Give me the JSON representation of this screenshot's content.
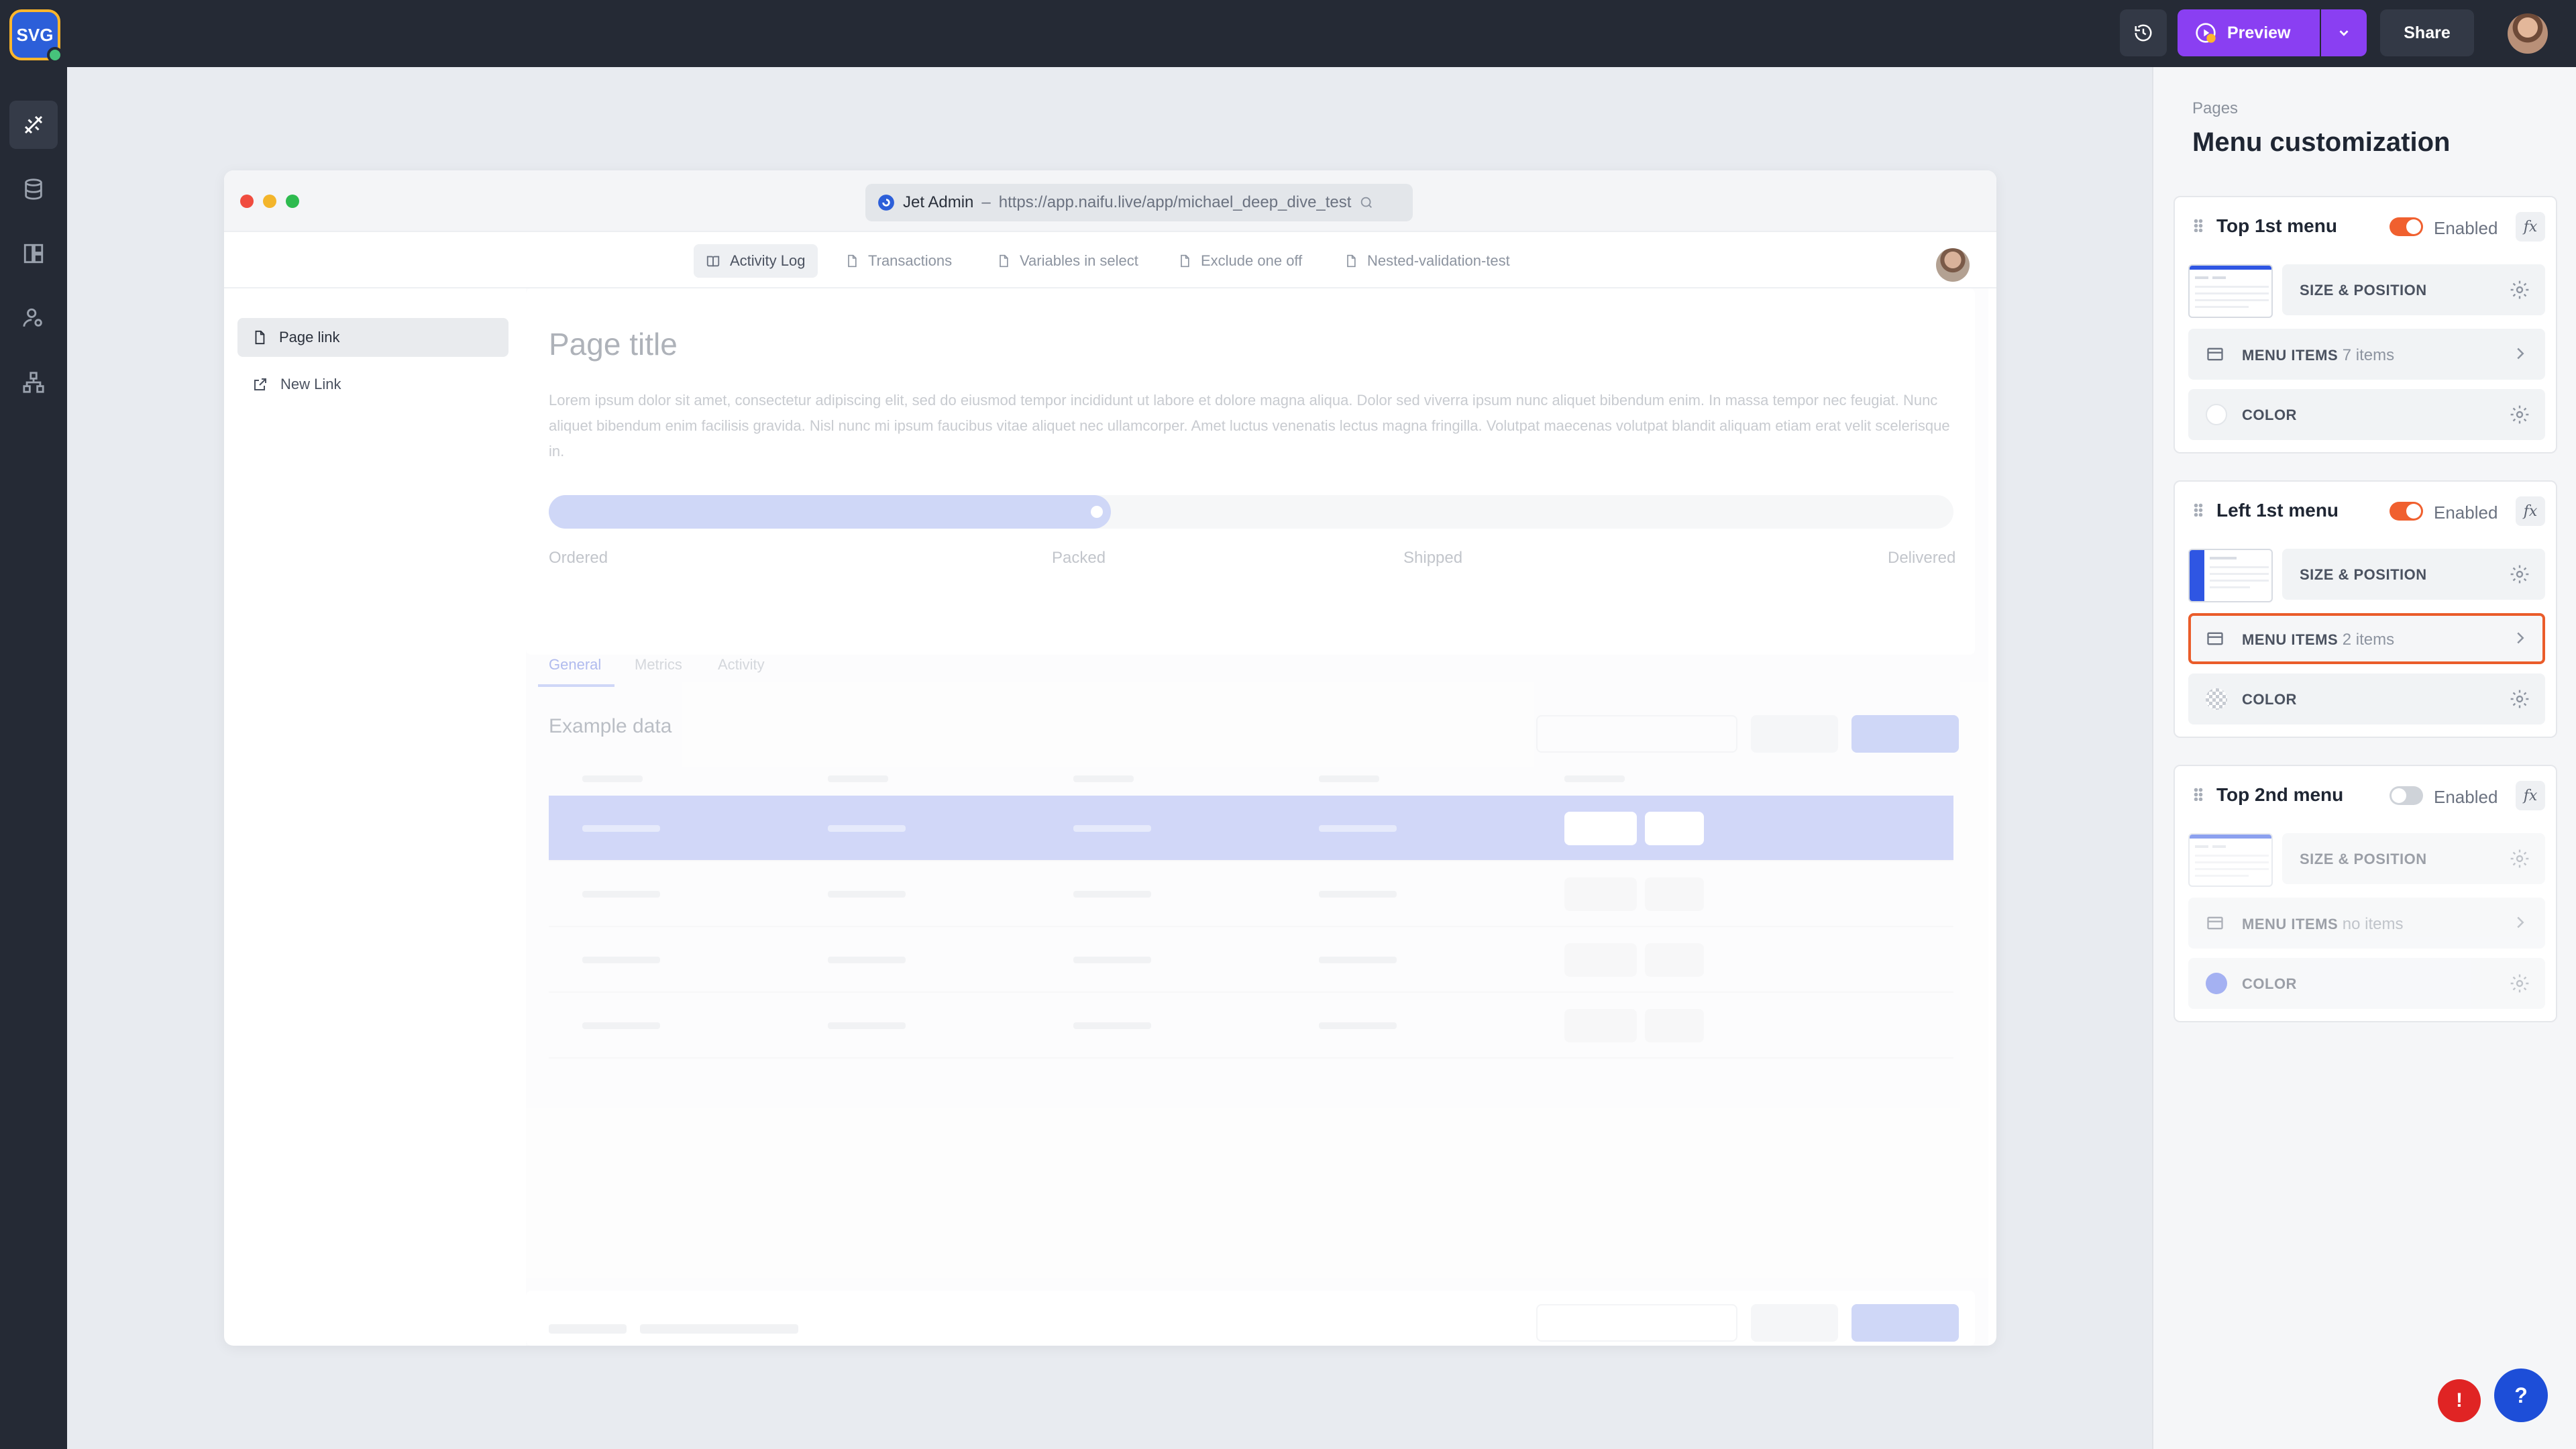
{
  "topbar": {
    "logo_text": "SVG",
    "preview_label": "Preview",
    "share_label": "Share",
    "accent_color": "#8a3ff2"
  },
  "leftnav": {
    "items": [
      {
        "icon": "design-tools-icon",
        "active": true
      },
      {
        "icon": "database-icon",
        "active": false
      },
      {
        "icon": "layout-icon",
        "active": false
      },
      {
        "icon": "users-settings-icon",
        "active": false
      },
      {
        "icon": "sitemap-icon",
        "active": false
      }
    ]
  },
  "panel": {
    "breadcrumb": "Pages",
    "title": "Menu customization",
    "enabled_label": "Enabled",
    "fx_label": "fx",
    "size_position_label": "SIZE & POSITION",
    "menu_items_label": "MENU ITEMS",
    "color_label": "COLOR",
    "menus": [
      {
        "name": "Top 1st menu",
        "enabled": true,
        "items_count": "7 items",
        "swatch": "#ffffff"
      },
      {
        "name": "Left 1st menu",
        "enabled": true,
        "items_count": "2 items",
        "swatch": "checkered",
        "highlighted": true
      },
      {
        "name": "Top 2nd menu",
        "enabled": false,
        "items_count": "no items",
        "swatch": "#5b72e8"
      }
    ]
  },
  "browser": {
    "url_app": "Jet Admin",
    "url_separator": "–",
    "url": "https://app.naifu.live/app/michael_deep_dive_test",
    "tabs": [
      "Activity Log",
      "Transactions",
      "Variables in select",
      "Exclude one off",
      "Nested-validation-test"
    ],
    "active_tab": 0,
    "sidebar": [
      "Page link",
      "New Link"
    ],
    "page_title": "Page title",
    "lorem": "Lorem ipsum dolor sit amet, consectetur adipiscing elit, sed do eiusmod tempor incididunt ut labore et dolore magna aliqua. Dolor sed viverra ipsum nunc aliquet bibendum enim. In massa tempor nec feugiat. Nunc aliquet bibendum enim facilisis gravida. Nisl nunc mi ipsum faucibus vitae aliquet nec ullamcorper. Amet luctus venenatis lectus magna fringilla. Volutpat maecenas volutpat blandit aliquam etiam erat velit scelerisque in.",
    "progress": {
      "steps": [
        "Ordered",
        "Packed",
        "Shipped",
        "Delivered"
      ],
      "completed_fraction": 0.4
    },
    "data_tabs": [
      "General",
      "Metrics",
      "Activity"
    ],
    "example_title": "Example data"
  }
}
